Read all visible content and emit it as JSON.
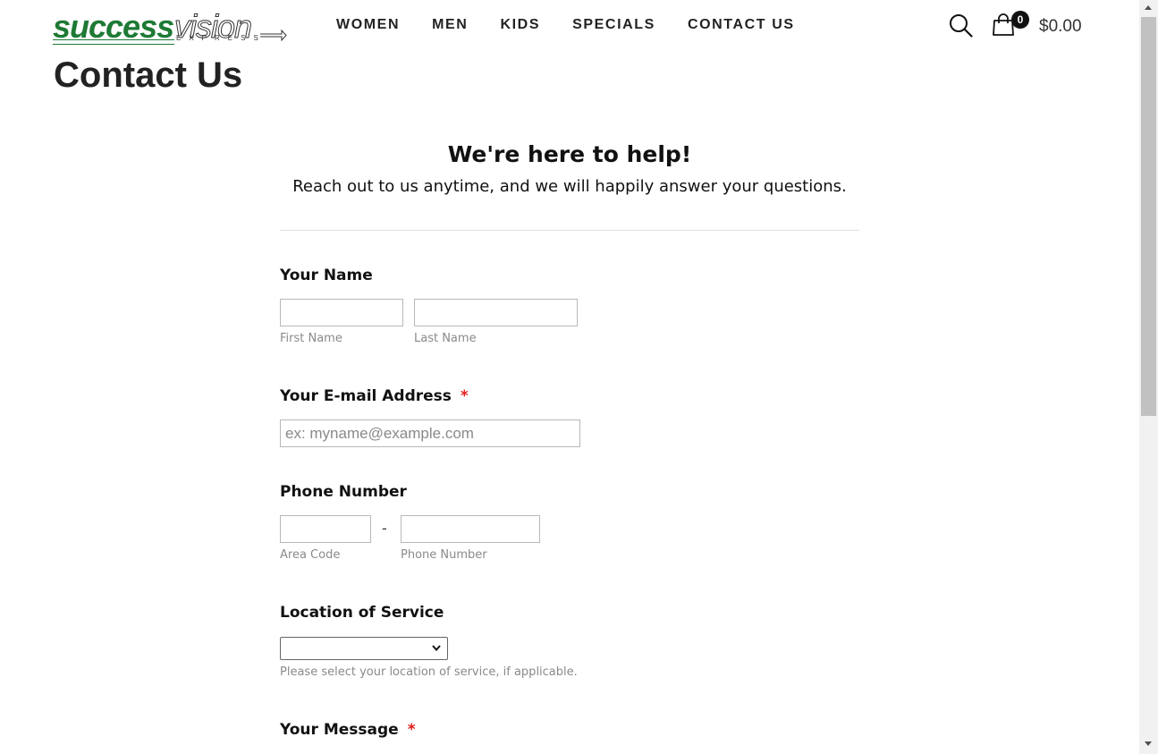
{
  "brand": {
    "logo_word1": "success",
    "logo_word2": "vision",
    "logo_word3": "EXPRESS",
    "colors": {
      "logo_green": "#1e7a35",
      "required_star": "#e21d1d",
      "hint_text": "#8a8a8a"
    }
  },
  "nav": {
    "items": [
      {
        "label": "WOMEN"
      },
      {
        "label": "MEN"
      },
      {
        "label": "KIDS"
      },
      {
        "label": "SPECIALS"
      },
      {
        "label": "CONTACT US"
      }
    ]
  },
  "header": {
    "search_icon": "search-icon",
    "cart_icon": "shopping-bag-icon",
    "cart_count": "0",
    "cart_total": "$0.00"
  },
  "page": {
    "title": "Contact Us"
  },
  "form": {
    "heading": "We're here to help!",
    "subheading": "Reach out to us anytime, and we will happily answer your questions.",
    "name": {
      "label": "Your Name",
      "first_value": "",
      "last_value": "",
      "first_sublabel": "First Name",
      "last_sublabel": "Last Name"
    },
    "email": {
      "label": "Your E-mail Address",
      "required_mark": "*",
      "value": "",
      "placeholder": "ex: myname@example.com"
    },
    "phone": {
      "label": "Phone Number",
      "separator": "-",
      "area_value": "",
      "number_value": "",
      "area_sublabel": "Area Code",
      "number_sublabel": "Phone Number"
    },
    "location": {
      "label": "Location of Service",
      "selected": "",
      "hint": "Please select your location of service, if applicable."
    },
    "message": {
      "label": "Your Message",
      "required_mark": "*"
    }
  }
}
